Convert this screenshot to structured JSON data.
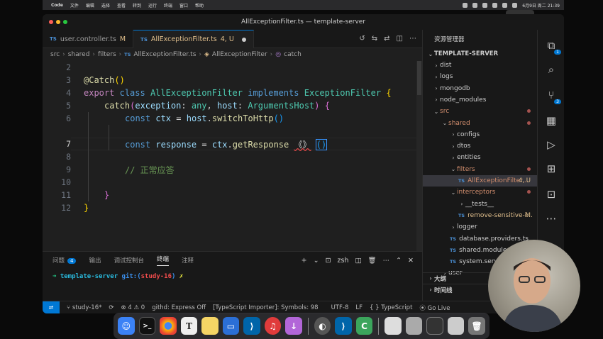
{
  "menubar": {
    "app": "Code",
    "items": [
      "文件",
      "编辑",
      "选择",
      "查看",
      "转到",
      "运行",
      "终端",
      "窗口",
      "帮助"
    ],
    "clock": "6月9日 周二 21:39"
  },
  "ime": {
    "label": "中文"
  },
  "window": {
    "title": "AllExceptionFilter.ts — template-server"
  },
  "tabs": [
    {
      "icon": "TS",
      "label": "user.controller.ts",
      "status": "M"
    },
    {
      "icon": "TS",
      "label": "AllExceptionFilter.ts",
      "status": "4, U"
    }
  ],
  "breadcrumb": [
    "src",
    "shared",
    "filters",
    "AllExceptionFilter.ts",
    "AllExceptionFilter",
    "catch"
  ],
  "editor": {
    "lines": [
      {
        "num": "2"
      },
      {
        "num": "3",
        "decorator": "@Catch",
        "paren": "()"
      },
      {
        "num": "4",
        "kw1": "export",
        "kw2": "class",
        "name": "AllExceptionFilter",
        "kw3": "implements",
        "iface": "ExceptionFilter",
        "brace": "{"
      },
      {
        "num": "5",
        "fn": "catch",
        "p1": "exception",
        "t1": "any",
        "p2": "host",
        "t2": "ArgumentsHost",
        "brace": "{"
      },
      {
        "num": "6",
        "kw": "const",
        "var": "ctx",
        "obj": "host",
        "method": "switchToHttp",
        "call": "()"
      },
      {
        "num": "7",
        "kw": "const",
        "var": "response",
        "obj": "ctx",
        "method": "getResponse",
        "generic": "《》",
        "call": "()"
      },
      {
        "num": "8"
      },
      {
        "num": "9",
        "comment": "// 正常应答"
      },
      {
        "num": "10"
      },
      {
        "num": "11",
        "brace": "}"
      },
      {
        "num": "12",
        "brace": "}"
      }
    ]
  },
  "panel": {
    "tabs": [
      "问题",
      "输出",
      "调试控制台",
      "终端",
      "注释"
    ],
    "problems_count": "4",
    "shell": "zsh",
    "prompt": {
      "arrow": "➜",
      "dir": "template-server",
      "git": "git:(",
      "branch": "study-16",
      "close": ")",
      "mark": "✗"
    }
  },
  "statusbar": {
    "branch": "study-16*",
    "errors": "4",
    "warnings": "0",
    "githd": "githd: Express Off",
    "importer": "[TypeScript Importer]: Symbols: 98",
    "encoding": "UTF-8",
    "eol": "LF",
    "lang": "TypeScript",
    "golive": "Go Live"
  },
  "sidebar": {
    "title": "资源管理器",
    "root": "TEMPLATE-SERVER",
    "items": [
      {
        "label": "dist",
        "depth": 1,
        "type": "folder-closed"
      },
      {
        "label": "logs",
        "depth": 1,
        "type": "folder-closed"
      },
      {
        "label": "mongodb",
        "depth": 1,
        "type": "folder-closed"
      },
      {
        "label": "node_modules",
        "depth": 1,
        "type": "folder-closed"
      },
      {
        "label": "src",
        "depth": 1,
        "type": "folder-open"
      },
      {
        "label": "shared",
        "depth": 2,
        "type": "folder-open"
      },
      {
        "label": "configs",
        "depth": 3,
        "type": "folder-closed"
      },
      {
        "label": "dtos",
        "depth": 3,
        "type": "folder-closed"
      },
      {
        "label": "entities",
        "depth": 3,
        "type": "folder-closed"
      },
      {
        "label": "filters",
        "depth": 3,
        "type": "folder-open"
      },
      {
        "label": "AllExceptionFilter...",
        "depth": 4,
        "type": "ts-file",
        "status": "4, U"
      },
      {
        "label": "interceptors",
        "depth": 3,
        "type": "folder-open"
      },
      {
        "label": "__tests__",
        "depth": 4,
        "type": "folder-closed"
      },
      {
        "label": "remove-sensitive-i...",
        "depth": 4,
        "type": "ts-file",
        "status": "M"
      },
      {
        "label": "logger",
        "depth": 3,
        "type": "folder-closed"
      },
      {
        "label": "database.providers.ts",
        "depth": 3,
        "type": "ts-file"
      },
      {
        "label": "shared.module.ts",
        "depth": 3,
        "type": "ts-file"
      },
      {
        "label": "system.service",
        "depth": 3,
        "type": "ts-file"
      },
      {
        "label": "user",
        "depth": 2,
        "type": "folder-closed"
      }
    ],
    "outline": "大纲",
    "timeline": "时间线"
  },
  "activity": {
    "explorer_badge": "1",
    "scm_badge": "3"
  },
  "colors": {
    "accent": "#0078d4",
    "modified": "#e2c08d",
    "error": "#f14c4c"
  }
}
